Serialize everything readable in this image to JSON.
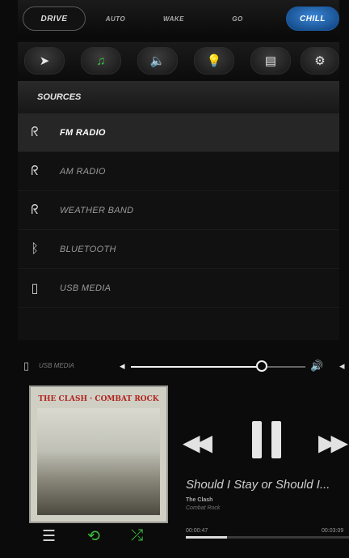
{
  "modes": {
    "drive": "DRIVE",
    "mode2": "AUTO",
    "mode3": "WAKE",
    "mode4": "GO",
    "chill": "CHILL"
  },
  "iconbar": [
    {
      "icon": "navigation-arrow-icon",
      "glyph": "➤"
    },
    {
      "icon": "music-note-icon",
      "glyph": "♫"
    },
    {
      "icon": "speaker-icon",
      "glyph": "🔈"
    },
    {
      "icon": "light-bulb-icon",
      "glyph": "💡"
    },
    {
      "icon": "storage-icon",
      "glyph": "▤"
    },
    {
      "icon": "gear-icon",
      "glyph": "⚙"
    }
  ],
  "sources": {
    "heading": "SOURCES",
    "items": [
      {
        "label": "FM RADIO",
        "icon": "radio-icon",
        "glyph": "ᖇ",
        "selected": true
      },
      {
        "label": "AM RADIO",
        "icon": "radio-icon",
        "glyph": "ᖇ",
        "selected": false
      },
      {
        "label": "WEATHER BAND",
        "icon": "radio-icon",
        "glyph": "ᖇ",
        "selected": false
      },
      {
        "label": "BLUETOOTH",
        "icon": "bluetooth-icon",
        "glyph": "ᛒ",
        "selected": false
      },
      {
        "label": "USB MEDIA",
        "icon": "usb-icon",
        "glyph": "▯",
        "selected": false
      }
    ]
  },
  "volume": {
    "source_label": "USB MEDIA",
    "level": 0.75
  },
  "now_playing": {
    "album_art_title": "THE CLASH · COMBAT ROCK",
    "title": "Should I Stay or Should I...",
    "artist": "The Clash",
    "album": "Combat Rock",
    "elapsed": "00:00:47",
    "total": "00:03:09",
    "progress": 0.25
  },
  "colors": {
    "accent_green": "#3dbb3d",
    "chill_blue": "#1d5da3"
  }
}
